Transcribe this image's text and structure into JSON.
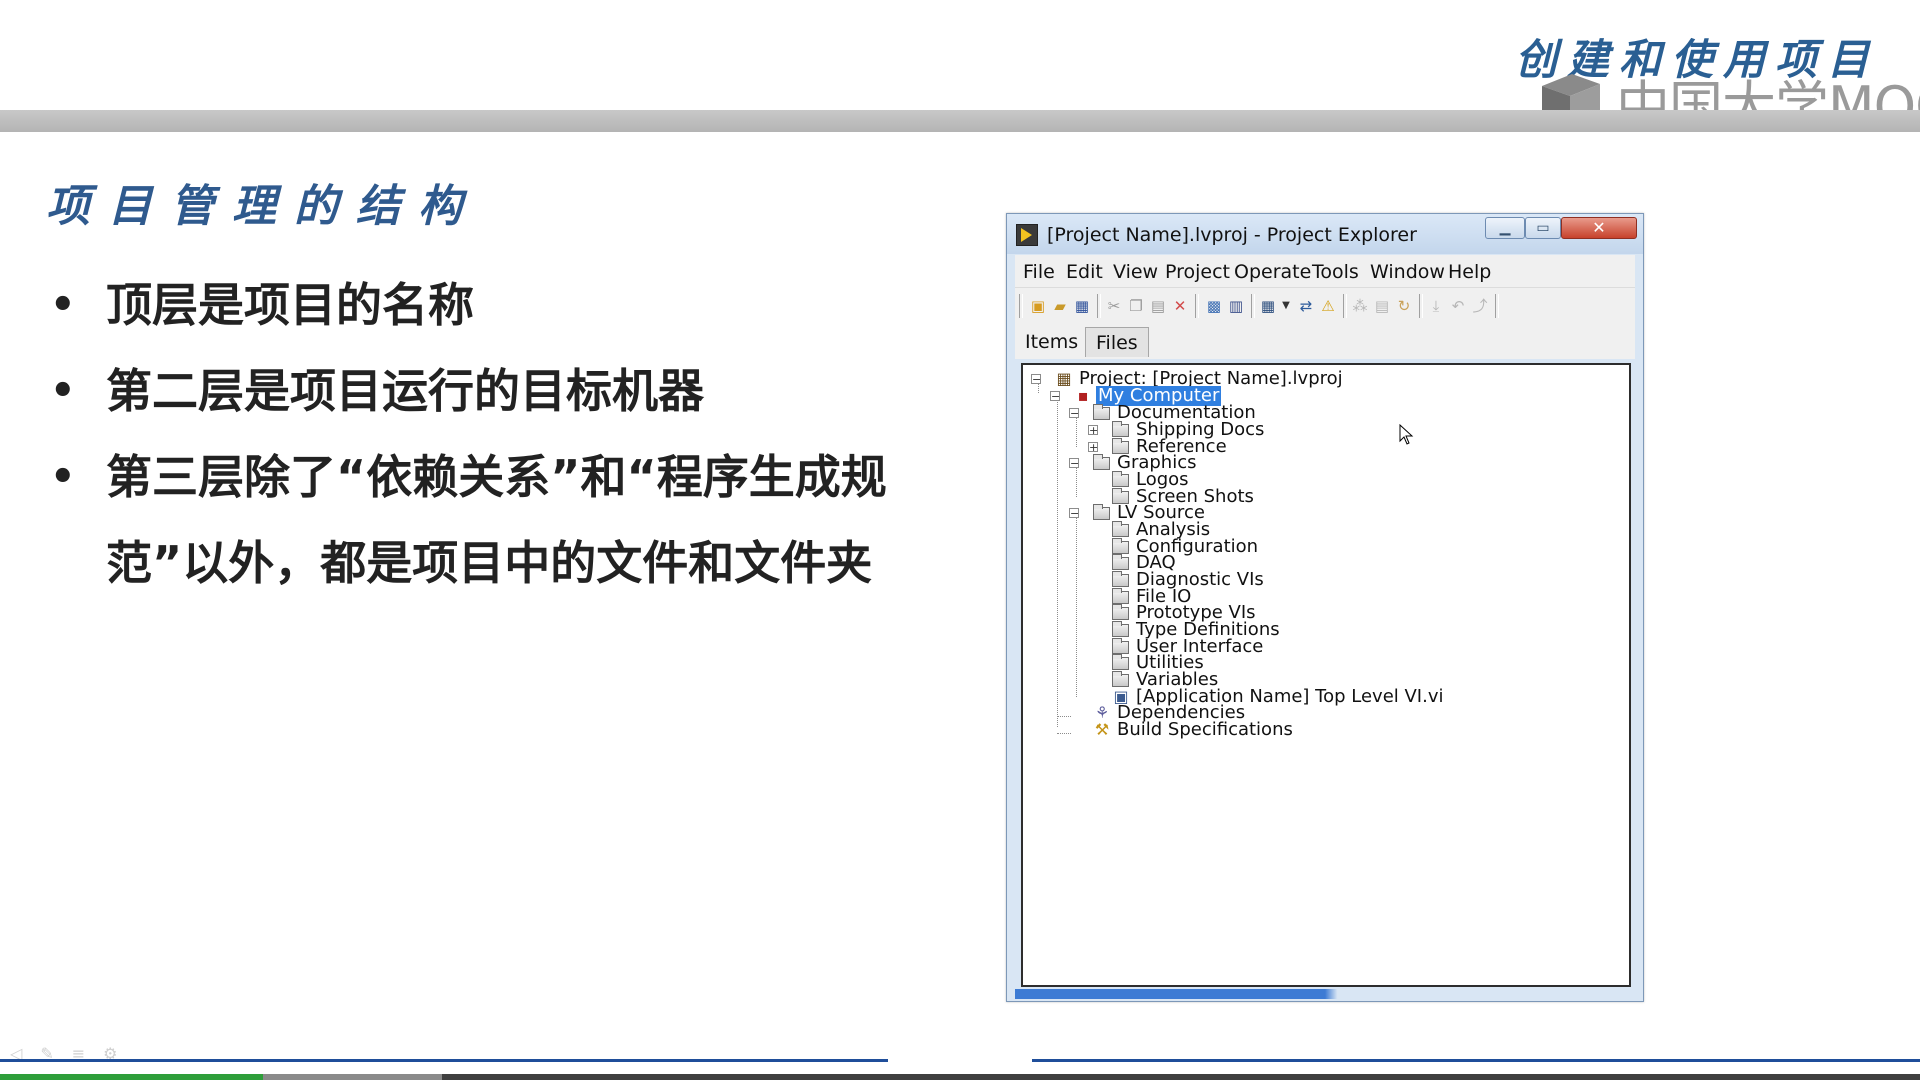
{
  "header": {
    "brand_title": "创建和使用项目",
    "logo_text": "中国大学MOOC",
    "logo_icon": "mooc-cube-icon"
  },
  "slide": {
    "heading": "项目管理的结构",
    "bullet_marker": "•",
    "bullets": [
      "顶层是项目的名称",
      "第二层是项目运行的目标机器",
      "第三层除了“依赖关系”和“程序生成规范”以外，都是项目中的文件和文件夹"
    ]
  },
  "window": {
    "title": "[Project Name].lvproj - Project Explorer",
    "app_icon": "labview-project-icon",
    "controls": {
      "minimize": "▁",
      "maximize": "▭",
      "close": "✕"
    },
    "menu": [
      "File",
      "Edit",
      "View",
      "Project",
      "Operate",
      "Tools",
      "Window",
      "Help"
    ],
    "toolbar_icons": [
      "new-icon",
      "open-icon",
      "save-all-icon",
      "cut-icon",
      "copy-icon",
      "paste-icon",
      "delete-icon",
      "build-icon",
      "deploy-icon",
      "view-icon",
      "resolve-icon",
      "warning-icon",
      "dependencies-icon",
      "show-files-icon",
      "refresh-icon",
      "compact-icon",
      "undo-icon",
      "redo-icon"
    ],
    "tabs": {
      "items": "Items",
      "files": "Files"
    },
    "tree": {
      "project": "Project: [Project Name].lvproj",
      "computer": "My Computer",
      "documentation": "Documentation",
      "shipping_docs": "Shipping Docs",
      "reference": "Reference",
      "graphics": "Graphics",
      "logos": "Logos",
      "screen_shots": "Screen Shots",
      "lv_source": "LV Source",
      "analysis": "Analysis",
      "configuration": "Configuration",
      "daq": "DAQ",
      "diagnostic_vis": "Diagnostic VIs",
      "file_io": "File IO",
      "prototype_vis": "Prototype VIs",
      "type_definitions": "Type Definitions",
      "user_interface": "User Interface",
      "utilities": "Utilities",
      "variables": "Variables",
      "top_level_vi": "[Application Name] Top Level VI.vi",
      "dependencies": "Dependencies",
      "build_specifications": "Build Specifications"
    }
  },
  "player": {
    "progress_fraction": 0.137,
    "buffered_fraction": 0.23
  },
  "colors": {
    "heading": "#2f5a8e",
    "selection": "#2f7fe0",
    "progress": "#2e9e3a",
    "rule_line": "#1f4e9a"
  }
}
